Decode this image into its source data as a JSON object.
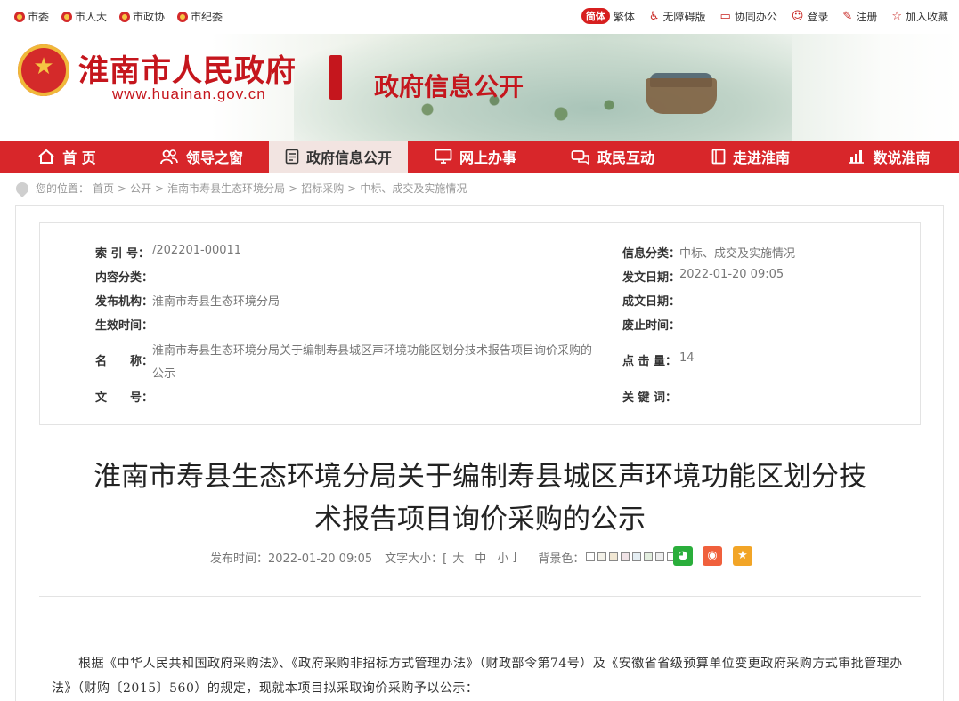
{
  "topbar": {
    "left_links": [
      "市委",
      "市人大",
      "市政协",
      "市纪委"
    ],
    "simplified_label": "简体",
    "traditional_label": "繁体",
    "accessibility_label": "无障碍版",
    "collab_label": "协同办公",
    "login_label": "登录",
    "register_label": "注册",
    "favorite_label": "加入收藏"
  },
  "banner": {
    "site_title": "淮南市人民政府",
    "site_url": "www.huainan.gov.cn",
    "section_title": "政府信息公开"
  },
  "nav": {
    "items": [
      {
        "label": "首 页",
        "icon": "home-icon"
      },
      {
        "label": "领导之窗",
        "icon": "people-icon"
      },
      {
        "label": "政府信息公开",
        "icon": "document-icon"
      },
      {
        "label": "网上办事",
        "icon": "monitor-icon"
      },
      {
        "label": "政民互动",
        "icon": "chat-icon"
      },
      {
        "label": "走进淮南",
        "icon": "book-icon"
      },
      {
        "label": "数说淮南",
        "icon": "chart-icon"
      }
    ]
  },
  "breadcrumb": {
    "prefix": "您的位置：",
    "items": [
      "首页",
      "公开",
      "淮南市寿县生态环境分局",
      "招标采购",
      "中标、成交及实施情况"
    ],
    "separator": ">"
  },
  "meta": {
    "index_label": "索 引 号：",
    "index_value": "/202201-00011",
    "category_label": "信息分类：",
    "category_value": "中标、成交及实施情况",
    "content_class_label": "内容分类：",
    "content_class_value": "",
    "issue_date_label": "发文日期：",
    "issue_date_value": "2022-01-20 09:05",
    "publisher_label": "发布机构：",
    "publisher_value": "淮南市寿县生态环境分局",
    "written_date_label": "成文日期：",
    "written_date_value": "",
    "effective_label": "生效时间：",
    "effective_value": "",
    "expire_label": "废止时间：",
    "expire_value": "",
    "name_label": "名　　称：",
    "name_value_line1": "淮南市寿县生态环境分局关于编制寿县城区声环境功能区划分技术报告项目询价采购的",
    "name_value_line2": "公示",
    "clicks_label": "点 击 量：",
    "clicks_value": "14",
    "doc_no_label": "文　　号：",
    "doc_no_value": "",
    "keywords_label": "关 键 词：",
    "keywords_value": ""
  },
  "article": {
    "title_line1": "淮南市寿县生态环境分局关于编制寿县城区声环境功能区划分技",
    "title_line2": "术报告项目询价采购的公示",
    "publish_time_label": "发布时间：2022-01-20 09:05",
    "font_size_label": "文字大小：[",
    "font_large": "大",
    "font_medium": "中",
    "font_small": "小",
    "font_close": "]",
    "bg_label": "背景色：",
    "bg_swatches": [
      "#ffffff",
      "#f4f2e9",
      "#f1e7d3",
      "#f0e3e6",
      "#e5eef3",
      "#e3eedf",
      "#eeeeee",
      "#ffffff"
    ],
    "body_line1": "根据《中华人民共和国政府采购法》、《政府采购非招标方式管理办法》（财政部令第74号）及《安徽省省级预算单位变更政",
    "body_line2": "府采购方式审批管理办法》（财购〔2015〕560）的规定，现就本项目拟采取询价采购予以公示："
  },
  "share": {
    "wechat_color": "#2aae3b",
    "weibo_color": "#f0603c",
    "favorite_color": "#f2a527"
  }
}
